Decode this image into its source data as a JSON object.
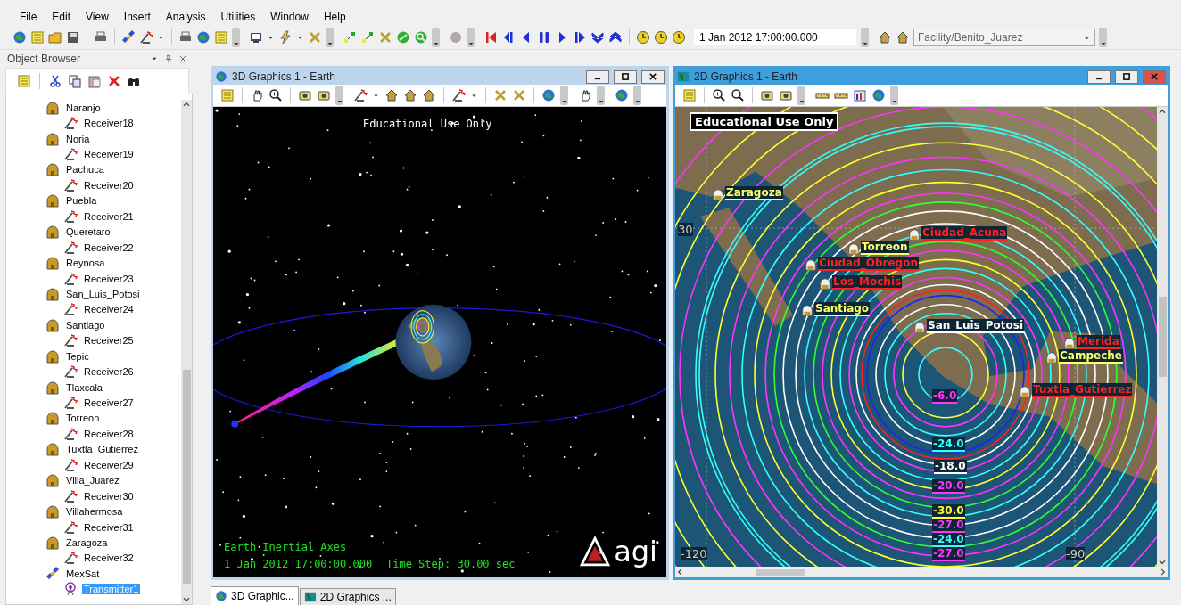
{
  "menu": [
    "File",
    "Edit",
    "View",
    "Insert",
    "Analysis",
    "Utilities",
    "Window",
    "Help"
  ],
  "toolbar": {
    "time": "1 Jan 2012 17:00:00.000",
    "object": "Facility/Benito_Juarez"
  },
  "object_browser": {
    "title": "Object Browser",
    "items": [
      {
        "label": "Naranjo",
        "kind": "facility",
        "selected": false,
        "children": [
          {
            "label": "Receiver18",
            "kind": "receiver",
            "selected": false
          }
        ]
      },
      {
        "label": "Noria",
        "kind": "facility",
        "selected": false,
        "children": [
          {
            "label": "Receiver19",
            "kind": "receiver",
            "selected": false
          }
        ]
      },
      {
        "label": "Pachuca",
        "kind": "facility",
        "selected": false,
        "children": [
          {
            "label": "Receiver20",
            "kind": "receiver",
            "selected": false
          }
        ]
      },
      {
        "label": "Puebla",
        "kind": "facility",
        "selected": false,
        "children": [
          {
            "label": "Receiver21",
            "kind": "receiver",
            "selected": false
          }
        ]
      },
      {
        "label": "Queretaro",
        "kind": "facility",
        "selected": false,
        "children": [
          {
            "label": "Receiver22",
            "kind": "receiver",
            "selected": false
          }
        ]
      },
      {
        "label": "Reynosa",
        "kind": "facility",
        "selected": false,
        "children": [
          {
            "label": "Receiver23",
            "kind": "receiver",
            "selected": false
          }
        ]
      },
      {
        "label": "San_Luis_Potosi",
        "kind": "facility",
        "selected": false,
        "children": [
          {
            "label": "Receiver24",
            "kind": "receiver",
            "selected": false
          }
        ]
      },
      {
        "label": "Santiago",
        "kind": "facility",
        "selected": false,
        "children": [
          {
            "label": "Receiver25",
            "kind": "receiver",
            "selected": false
          }
        ]
      },
      {
        "label": "Tepic",
        "kind": "facility",
        "selected": false,
        "children": [
          {
            "label": "Receiver26",
            "kind": "receiver",
            "selected": false
          }
        ]
      },
      {
        "label": "Tlaxcala",
        "kind": "facility",
        "selected": false,
        "children": [
          {
            "label": "Receiver27",
            "kind": "receiver",
            "selected": false
          }
        ]
      },
      {
        "label": "Torreon",
        "kind": "facility",
        "selected": false,
        "children": [
          {
            "label": "Receiver28",
            "kind": "receiver",
            "selected": false
          }
        ]
      },
      {
        "label": "Tuxtla_Gutierrez",
        "kind": "facility",
        "selected": false,
        "children": [
          {
            "label": "Receiver29",
            "kind": "receiver",
            "selected": false
          }
        ]
      },
      {
        "label": "Villa_Juarez",
        "kind": "facility",
        "selected": false,
        "children": [
          {
            "label": "Receiver30",
            "kind": "receiver",
            "selected": false
          }
        ]
      },
      {
        "label": "Villahermosa",
        "kind": "facility",
        "selected": false,
        "children": [
          {
            "label": "Receiver31",
            "kind": "receiver",
            "selected": false
          }
        ]
      },
      {
        "label": "Zaragoza",
        "kind": "facility",
        "selected": false,
        "children": [
          {
            "label": "Receiver32",
            "kind": "receiver",
            "selected": false
          }
        ]
      },
      {
        "label": "MexSat",
        "kind": "satellite",
        "selected": false,
        "children": [
          {
            "label": "Transmitter1",
            "kind": "transmitter",
            "selected": true
          }
        ]
      }
    ]
  },
  "windows": [
    {
      "kind": "scene",
      "title": "3D Graphics 1 - Earth",
      "active": false,
      "watermark": "Educational Use Only",
      "axes": "Earth Inertial Axes",
      "time": "1 Jan 2012 17:00:00.000",
      "time_step": "Time Step: 30.00 sec",
      "logo": "agi"
    },
    {
      "kind": "map",
      "title": "2D Graphics 1 - Earth",
      "active": true,
      "watermark": "Educational Use Only",
      "grid_labels": [
        "30",
        "-120",
        "-90"
      ],
      "place_labels": [
        {
          "text": "Zaragoza",
          "color": "#ffff66"
        },
        {
          "text": "Ciudad_Acuna",
          "color": "#ff2020"
        },
        {
          "text": "Torreon",
          "color": "#ffff66"
        },
        {
          "text": "Ciudad_Obregon",
          "color": "#ff2020"
        },
        {
          "text": "Los_Mochis",
          "color": "#ff2020"
        },
        {
          "text": "Santiago",
          "color": "#ffff66"
        },
        {
          "text": "San_Luis_Potosi",
          "color": "#ffffff"
        },
        {
          "text": "Merida",
          "color": "#ff2020"
        },
        {
          "text": "Campeche",
          "color": "#ffff66"
        },
        {
          "text": "Tuxtla_Gutierrez",
          "color": "#ff2020"
        }
      ],
      "contour_labels": [
        {
          "text": "-6.0",
          "color": "#ff33ff"
        },
        {
          "text": "-24.0",
          "color": "#33ffff"
        },
        {
          "text": "-18.0",
          "color": "#ffffff"
        },
        {
          "text": "-20.0",
          "color": "#ff33ff"
        },
        {
          "text": "-30.0",
          "color": "#ffff33"
        },
        {
          "text": "-27.0",
          "color": "#ff33ff"
        },
        {
          "text": "-24.0",
          "color": "#33ffff"
        },
        {
          "text": "-27.0",
          "color": "#ff33ff"
        }
      ]
    }
  ],
  "tabs": [
    {
      "label": "3D Graphic...",
      "kind": "scene",
      "selected": true
    },
    {
      "label": "2D Graphics ...",
      "kind": "map",
      "selected": false
    }
  ]
}
